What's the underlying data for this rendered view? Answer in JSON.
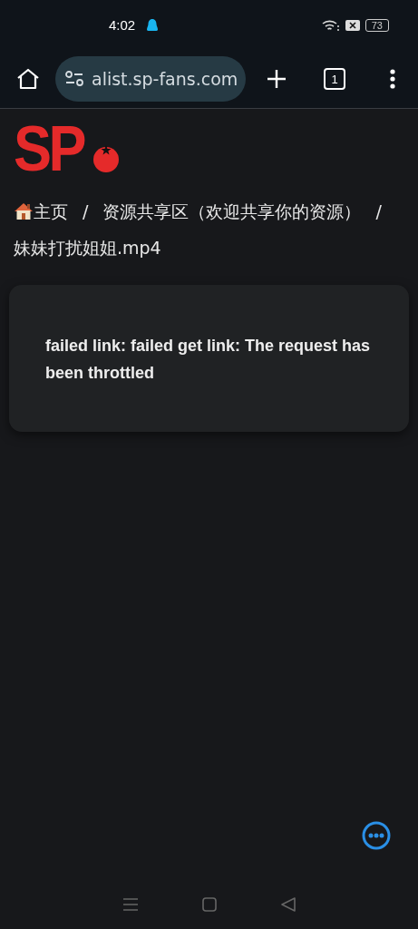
{
  "status_bar": {
    "time": "4:02",
    "battery": "73"
  },
  "browser": {
    "url": "alist.sp-fans.com",
    "tab_count": "1"
  },
  "logo": {
    "text": "SP"
  },
  "breadcrumb_separator": "/",
  "breadcrumb": [
    {
      "label": "主页",
      "kind": "home"
    },
    {
      "label": "资源共享区（欢迎共享你的资源）",
      "kind": "folder"
    },
    {
      "label": "妹妹打扰姐姐.mp4",
      "kind": "file"
    }
  ],
  "error": {
    "message": "failed link: failed get link: The request has been throttled"
  }
}
